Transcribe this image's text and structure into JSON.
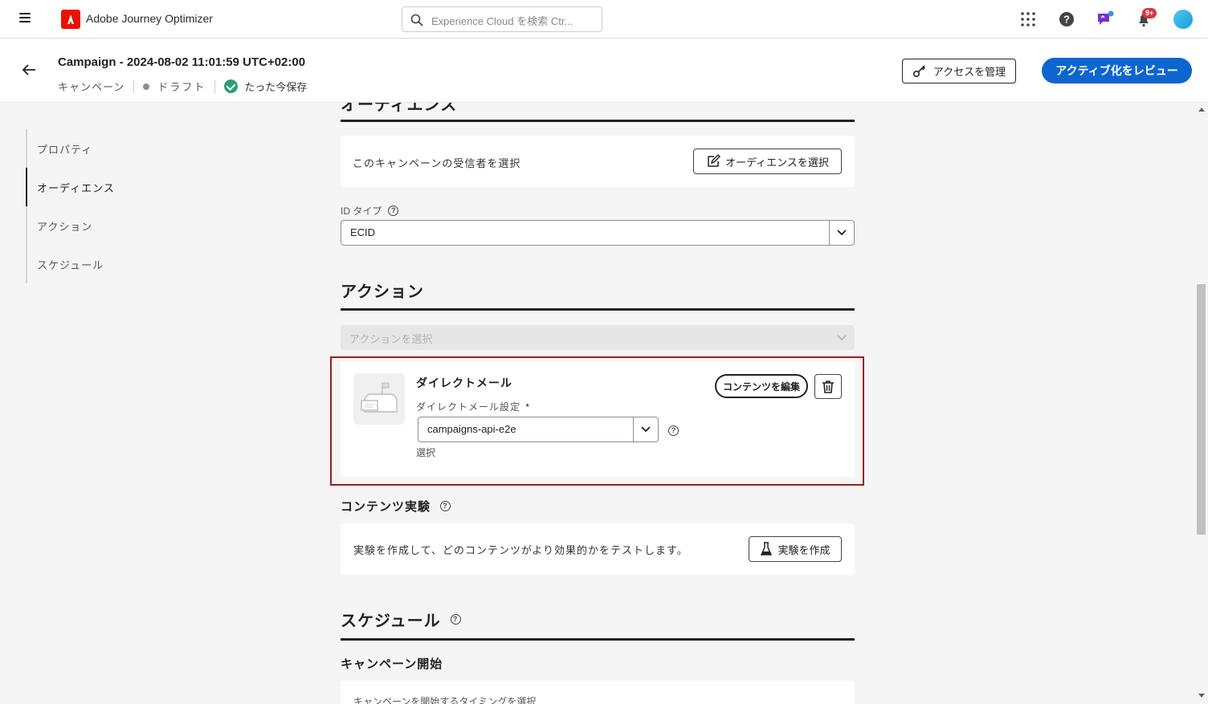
{
  "app": {
    "name": "Adobe Journey Optimizer",
    "search_placeholder": "Experience Cloud を検索 Ctr...",
    "notification_badge": "9+"
  },
  "campaign": {
    "title": "Campaign - 2024-08-02 11:01:59 UTC+02:00",
    "type_label": "キャンペーン",
    "status_label": "ドラフト",
    "saved_label": "たった今保存",
    "manage_access_label": "アクセスを管理",
    "review_label": "アクティブ化をレビュー"
  },
  "leftnav": {
    "items": [
      {
        "label": "プロパティ"
      },
      {
        "label": "オーディエンス"
      },
      {
        "label": "アクション"
      },
      {
        "label": "スケジュール"
      }
    ]
  },
  "audience": {
    "heading_partial": "オーディエンス",
    "description": "このキャンペーンの受信者を選択",
    "select_button_label": "オーディエンスを選択",
    "id_type_label": "ID タイプ",
    "id_type_value": "ECID"
  },
  "actions": {
    "heading": "アクション",
    "select_placeholder": "アクションを選択",
    "direct_mail": {
      "title": "ダイレクトメール",
      "config_label": "ダイレクトメール設定",
      "required_mark": "*",
      "config_value": "campaigns-api-e2e",
      "select_hint": "選択",
      "edit_content_label": "コンテンツを編集"
    }
  },
  "experiment": {
    "heading": "コンテンツ実験",
    "description": "実験を作成して、どのコンテンツがより効果的かをテストします。",
    "create_label": "実験を作成"
  },
  "schedule": {
    "heading": "スケジュール",
    "start_heading": "キャンペーン開始",
    "start_hint": "キャンペーンを開始するタイミングを選択"
  },
  "colors": {
    "accent": "#0d66d0",
    "highlight_border": "#9b1c1c",
    "logo": "#eb1000",
    "saved_check": "#2d9d78"
  }
}
